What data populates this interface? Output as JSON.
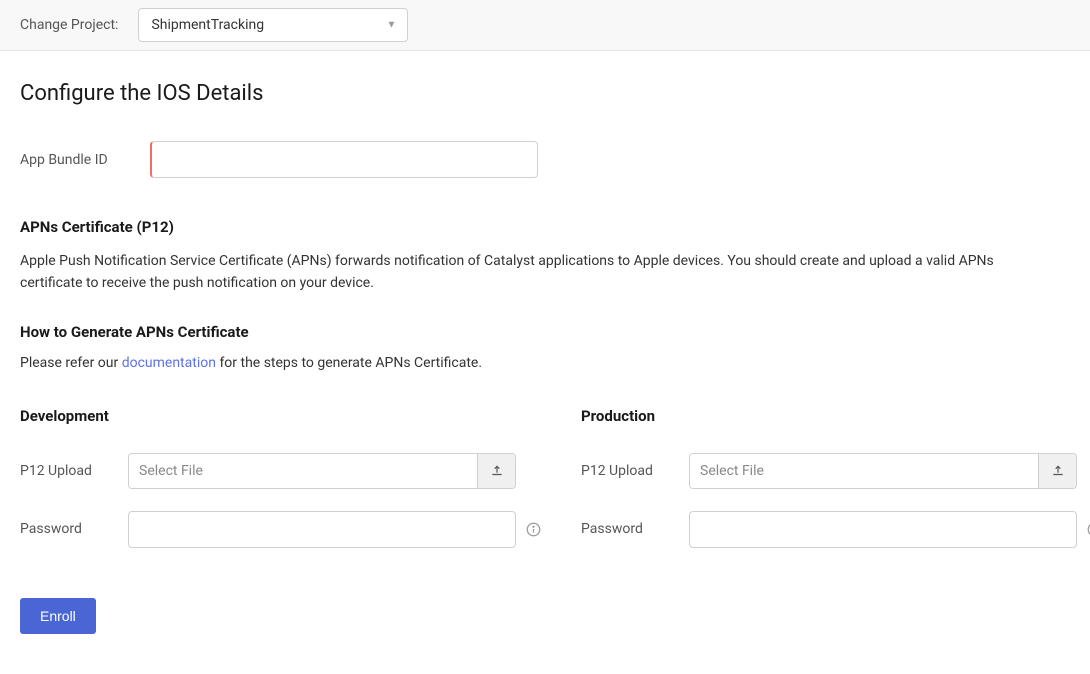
{
  "topbar": {
    "label": "Change Project:",
    "project": "ShipmentTracking"
  },
  "page": {
    "title": "Configure the IOS Details"
  },
  "bundle": {
    "label": "App Bundle ID",
    "value": ""
  },
  "apns": {
    "heading": "APNs Certificate (P12)",
    "description": "Apple Push Notification Service Certificate (APNs) forwards notification of Catalyst applications to Apple devices. You should create and upload a valid APNs certificate to receive the push notification on your device."
  },
  "howto": {
    "heading": "How to Generate APNs Certificate",
    "prefix": "Please refer our ",
    "link": "documentation",
    "suffix": " for the steps to generate APNs Certificate."
  },
  "development": {
    "heading": "Development",
    "upload_label": "P12 Upload",
    "upload_placeholder": "Select File",
    "password_label": "Password",
    "password_value": ""
  },
  "production": {
    "heading": "Production",
    "upload_label": "P12 Upload",
    "upload_placeholder": "Select File",
    "password_label": "Password",
    "password_value": ""
  },
  "actions": {
    "enroll": "Enroll"
  }
}
